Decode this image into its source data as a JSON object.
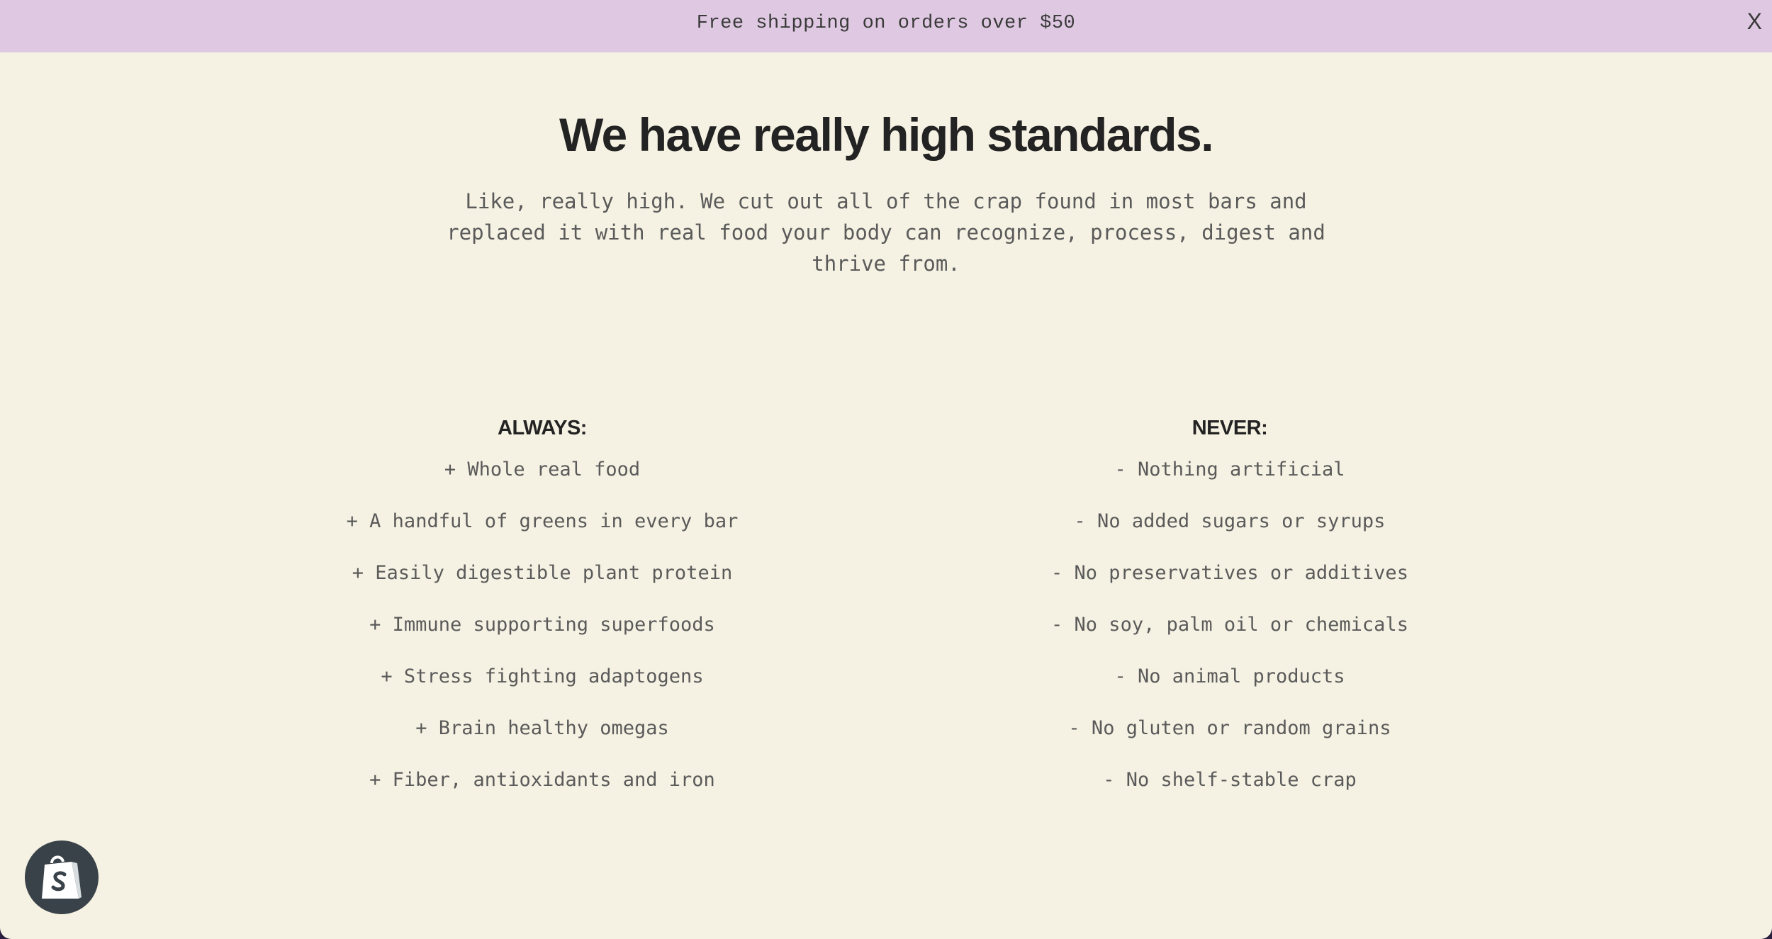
{
  "announcement": {
    "text": "Free shipping on orders over $50",
    "close_label": "X"
  },
  "hero": {
    "headline": "We have really high standards.",
    "intro": "Like, really high. We cut out all of the crap found in most bars and replaced it with real food your body can recognize, process, digest and thrive from."
  },
  "always": {
    "heading": "ALWAYS:",
    "items": [
      "+ Whole real food",
      "+ A handful of greens in every bar",
      "+ Easily digestible plant protein",
      "+ Immune supporting superfoods",
      "+ Stress fighting adaptogens",
      "+ Brain healthy omegas",
      "+ Fiber, antioxidants and iron"
    ]
  },
  "never": {
    "heading": "NEVER:",
    "items": [
      "- Nothing artificial",
      "- No added sugars or syrups",
      "- No preservatives or additives",
      "- No soy, palm oil or chemicals",
      "- No animal products",
      "- No gluten or random grains",
      "- No shelf-stable crap"
    ]
  },
  "icons": {
    "close": "close-icon",
    "shop": "shopify-bag-icon"
  },
  "colors": {
    "announcement_bg": "#dfc9e2",
    "page_bg": "#f6f2e3",
    "heading_text": "#232323",
    "body_text": "#5a5a5a",
    "badge_bg": "#394249"
  }
}
